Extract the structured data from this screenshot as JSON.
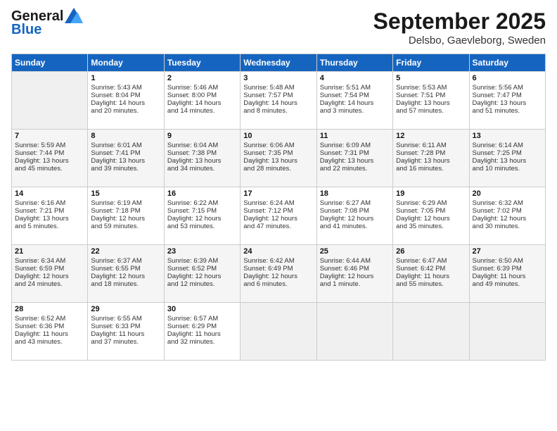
{
  "header": {
    "logo_line1": "General",
    "logo_line2": "Blue",
    "month": "September 2025",
    "location": "Delsbo, Gaevleborg, Sweden"
  },
  "days_of_week": [
    "Sunday",
    "Monday",
    "Tuesday",
    "Wednesday",
    "Thursday",
    "Friday",
    "Saturday"
  ],
  "weeks": [
    [
      {
        "day": "",
        "content": ""
      },
      {
        "day": "1",
        "content": "Sunrise: 5:43 AM\nSunset: 8:04 PM\nDaylight: 14 hours\nand 20 minutes."
      },
      {
        "day": "2",
        "content": "Sunrise: 5:46 AM\nSunset: 8:00 PM\nDaylight: 14 hours\nand 14 minutes."
      },
      {
        "day": "3",
        "content": "Sunrise: 5:48 AM\nSunset: 7:57 PM\nDaylight: 14 hours\nand 8 minutes."
      },
      {
        "day": "4",
        "content": "Sunrise: 5:51 AM\nSunset: 7:54 PM\nDaylight: 14 hours\nand 3 minutes."
      },
      {
        "day": "5",
        "content": "Sunrise: 5:53 AM\nSunset: 7:51 PM\nDaylight: 13 hours\nand 57 minutes."
      },
      {
        "day": "6",
        "content": "Sunrise: 5:56 AM\nSunset: 7:47 PM\nDaylight: 13 hours\nand 51 minutes."
      }
    ],
    [
      {
        "day": "7",
        "content": "Sunrise: 5:59 AM\nSunset: 7:44 PM\nDaylight: 13 hours\nand 45 minutes."
      },
      {
        "day": "8",
        "content": "Sunrise: 6:01 AM\nSunset: 7:41 PM\nDaylight: 13 hours\nand 39 minutes."
      },
      {
        "day": "9",
        "content": "Sunrise: 6:04 AM\nSunset: 7:38 PM\nDaylight: 13 hours\nand 34 minutes."
      },
      {
        "day": "10",
        "content": "Sunrise: 6:06 AM\nSunset: 7:35 PM\nDaylight: 13 hours\nand 28 minutes."
      },
      {
        "day": "11",
        "content": "Sunrise: 6:09 AM\nSunset: 7:31 PM\nDaylight: 13 hours\nand 22 minutes."
      },
      {
        "day": "12",
        "content": "Sunrise: 6:11 AM\nSunset: 7:28 PM\nDaylight: 13 hours\nand 16 minutes."
      },
      {
        "day": "13",
        "content": "Sunrise: 6:14 AM\nSunset: 7:25 PM\nDaylight: 13 hours\nand 10 minutes."
      }
    ],
    [
      {
        "day": "14",
        "content": "Sunrise: 6:16 AM\nSunset: 7:21 PM\nDaylight: 13 hours\nand 5 minutes."
      },
      {
        "day": "15",
        "content": "Sunrise: 6:19 AM\nSunset: 7:18 PM\nDaylight: 12 hours\nand 59 minutes."
      },
      {
        "day": "16",
        "content": "Sunrise: 6:22 AM\nSunset: 7:15 PM\nDaylight: 12 hours\nand 53 minutes."
      },
      {
        "day": "17",
        "content": "Sunrise: 6:24 AM\nSunset: 7:12 PM\nDaylight: 12 hours\nand 47 minutes."
      },
      {
        "day": "18",
        "content": "Sunrise: 6:27 AM\nSunset: 7:08 PM\nDaylight: 12 hours\nand 41 minutes."
      },
      {
        "day": "19",
        "content": "Sunrise: 6:29 AM\nSunset: 7:05 PM\nDaylight: 12 hours\nand 35 minutes."
      },
      {
        "day": "20",
        "content": "Sunrise: 6:32 AM\nSunset: 7:02 PM\nDaylight: 12 hours\nand 30 minutes."
      }
    ],
    [
      {
        "day": "21",
        "content": "Sunrise: 6:34 AM\nSunset: 6:59 PM\nDaylight: 12 hours\nand 24 minutes."
      },
      {
        "day": "22",
        "content": "Sunrise: 6:37 AM\nSunset: 6:55 PM\nDaylight: 12 hours\nand 18 minutes."
      },
      {
        "day": "23",
        "content": "Sunrise: 6:39 AM\nSunset: 6:52 PM\nDaylight: 12 hours\nand 12 minutes."
      },
      {
        "day": "24",
        "content": "Sunrise: 6:42 AM\nSunset: 6:49 PM\nDaylight: 12 hours\nand 6 minutes."
      },
      {
        "day": "25",
        "content": "Sunrise: 6:44 AM\nSunset: 6:46 PM\nDaylight: 12 hours\nand 1 minute."
      },
      {
        "day": "26",
        "content": "Sunrise: 6:47 AM\nSunset: 6:42 PM\nDaylight: 11 hours\nand 55 minutes."
      },
      {
        "day": "27",
        "content": "Sunrise: 6:50 AM\nSunset: 6:39 PM\nDaylight: 11 hours\nand 49 minutes."
      }
    ],
    [
      {
        "day": "28",
        "content": "Sunrise: 6:52 AM\nSunset: 6:36 PM\nDaylight: 11 hours\nand 43 minutes."
      },
      {
        "day": "29",
        "content": "Sunrise: 6:55 AM\nSunset: 6:33 PM\nDaylight: 11 hours\nand 37 minutes."
      },
      {
        "day": "30",
        "content": "Sunrise: 6:57 AM\nSunset: 6:29 PM\nDaylight: 11 hours\nand 32 minutes."
      },
      {
        "day": "",
        "content": ""
      },
      {
        "day": "",
        "content": ""
      },
      {
        "day": "",
        "content": ""
      },
      {
        "day": "",
        "content": ""
      }
    ]
  ]
}
